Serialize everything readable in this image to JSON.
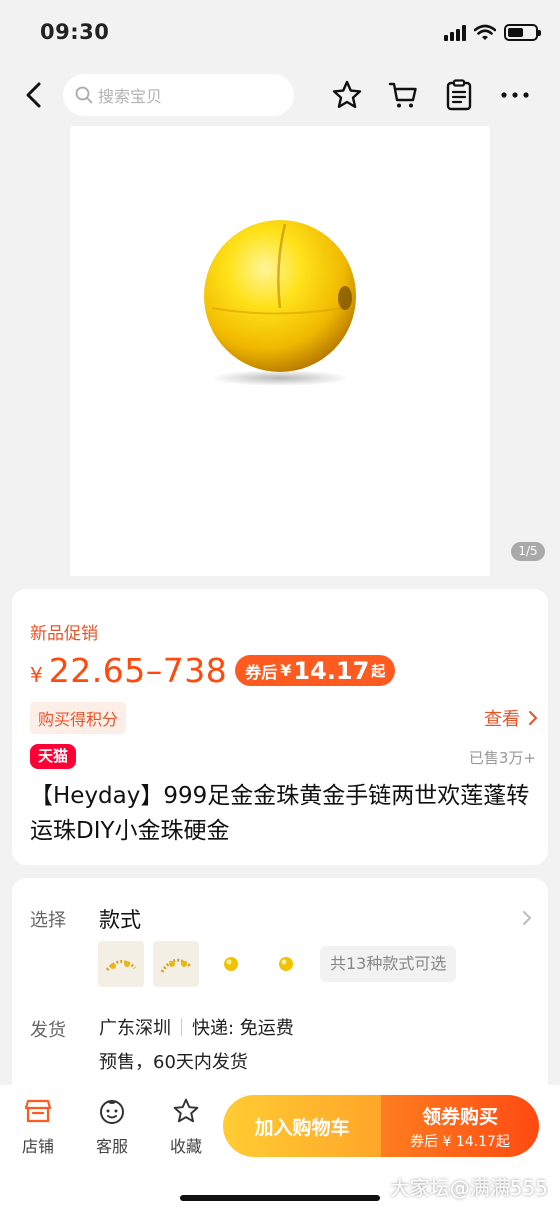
{
  "status_bar": {
    "time": "09:30"
  },
  "nav": {
    "search_placeholder": "搜索宝贝"
  },
  "gallery": {
    "page_indicator": "1/5"
  },
  "product": {
    "promo_label": "新品促销",
    "currency": "¥",
    "price_range": "22.65–738",
    "coupon_prefix": "券后",
    "coupon_currency": "¥",
    "coupon_price": "14.17",
    "coupon_suffix": "起",
    "points_badge": "购买得积分",
    "view_link": "查看",
    "tmall_badge": "天猫",
    "sold": "已售3万+",
    "title": "【Heyday】999足金金珠黄金手链两世欢莲蓬转运珠DIY小金珠硬金"
  },
  "options": {
    "select_label": "选择",
    "style_title": "款式",
    "more_styles": "共13种款式可选",
    "shipping_label": "发货",
    "ship_from": "广东深圳",
    "express": "快递: 免运费",
    "presale": "预售，60天内发货"
  },
  "bottom_bar": {
    "store": "店铺",
    "service": "客服",
    "favorite": "收藏",
    "add_to_cart": "加入购物车",
    "buy_main": "领券购买",
    "buy_sub": "券后 ¥ 14.17起"
  },
  "watermark": "大家坛@满满555",
  "colors": {
    "accent": "#ff4a0f",
    "tmall": "#ff0036",
    "cart": "#ffb52e",
    "buy": "#ff5a17"
  }
}
